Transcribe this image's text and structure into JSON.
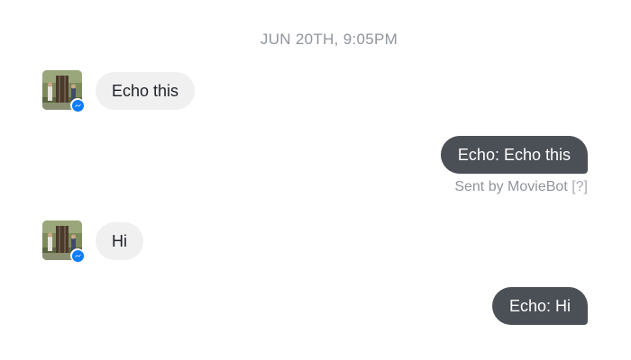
{
  "thread": {
    "timestamp": "JUN 20TH, 9:05PM",
    "messages": [
      {
        "direction": "incoming",
        "text": "Echo this"
      },
      {
        "direction": "outgoing",
        "text": "Echo: Echo this"
      },
      {
        "direction": "incoming",
        "text": "Hi"
      },
      {
        "direction": "outgoing",
        "text": "Echo: Hi"
      }
    ],
    "sent_by": {
      "prefix": "Sent by",
      "bot_name": "MovieBot",
      "help": "[?]"
    }
  },
  "icons": {
    "avatar_badge": "messenger-bolt-icon"
  },
  "colors": {
    "outgoing_bubble": "#4b4f56",
    "incoming_bubble": "#f1f0f0",
    "badge": "#0a7cff",
    "meta_text": "#90949c"
  }
}
